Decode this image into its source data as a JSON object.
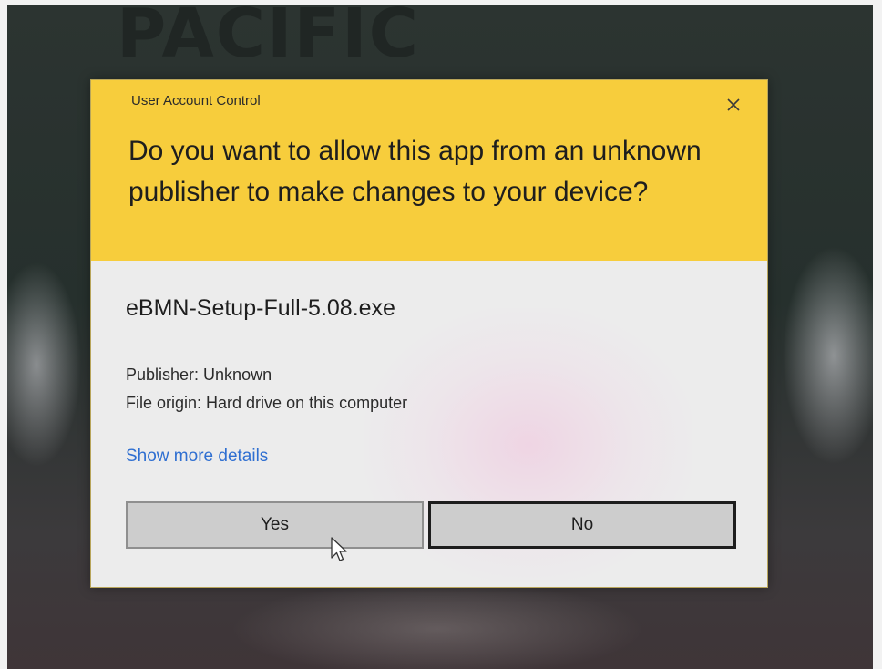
{
  "background": {
    "brand_text": "PACIFIC"
  },
  "dialog": {
    "title": "User Account Control",
    "question": "Do you want to allow this app from an unknown publisher to make changes to your device?",
    "app_name": "eBMN-Setup-Full-5.08.exe",
    "publisher": "Publisher: Unknown",
    "file_origin": "File origin: Hard drive on this computer",
    "details_link": "Show more details",
    "buttons": {
      "yes": "Yes",
      "no": "No"
    },
    "close_icon": "close-icon"
  },
  "colors": {
    "header": "#f7cd3c",
    "body": "#ececec",
    "link": "#2f6fd1",
    "button": "#cdcdcd"
  }
}
